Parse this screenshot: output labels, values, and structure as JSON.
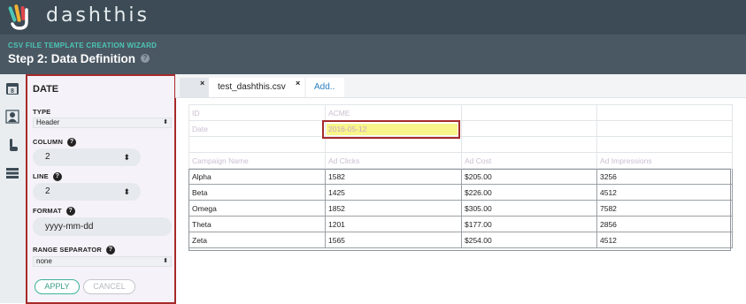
{
  "app": {
    "brand": "dashthis"
  },
  "wizard": {
    "kicker": "CSV FILE TEMPLATE CREATION WIZARD",
    "step_title": "Step 2: Data Definition",
    "help_glyph": "?"
  },
  "rail": {
    "icons": [
      "calendar-icon",
      "user-icon",
      "pointer-icon",
      "stack-icon"
    ],
    "calendar_label": "8"
  },
  "panel": {
    "title": "DATE",
    "type_label": "TYPE",
    "type_value": "Header",
    "column_label": "COLUMN",
    "column_value": "2",
    "line_label": "LINE",
    "line_value": "2",
    "format_label": "FORMAT",
    "format_value": "yyyy-mm-dd",
    "range_label": "RANGE SEPARATOR",
    "range_value": "none",
    "apply_label": "APPLY",
    "cancel_label": "CANCEL"
  },
  "tabs": {
    "file_name": "test_dashthis.csv",
    "add_label": "Add..",
    "close_glyph": "×"
  },
  "sheet": {
    "meta_rows": [
      [
        "ID",
        "ACME",
        "",
        ""
      ],
      [
        "Date",
        "2016-05-12",
        "",
        ""
      ],
      [
        "",
        "",
        "",
        ""
      ],
      [
        "Campaign Name",
        "Ad Clicks",
        "Ad Cost",
        "Ad Impressions"
      ]
    ],
    "data_rows": [
      [
        "Alpha",
        "1582",
        "$205.00",
        "3256"
      ],
      [
        "Beta",
        "1425",
        "$226.00",
        "4512"
      ],
      [
        "Omega",
        "1852",
        "$305.00",
        "7582"
      ],
      [
        "Theta",
        "1201",
        "$177.00",
        "2856"
      ],
      [
        "Zeta",
        "1565",
        "$254.00",
        "4512"
      ]
    ]
  },
  "colors": {
    "topbar": "#3c4b55",
    "wizardbar": "#4a5863",
    "accent_teal": "#4cc6b5",
    "selection_border": "#a62a2a",
    "highlight_yellow": "#f8f58a",
    "link_blue": "#2a7fc0"
  }
}
